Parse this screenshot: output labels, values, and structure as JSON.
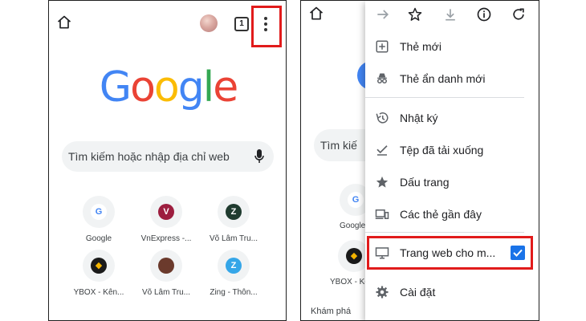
{
  "left": {
    "tab_count": "1",
    "logo_letters": [
      {
        "ch": "G",
        "color": "#4285F4"
      },
      {
        "ch": "o",
        "color": "#EA4335"
      },
      {
        "ch": "o",
        "color": "#FBBC05"
      },
      {
        "ch": "g",
        "color": "#4285F4"
      },
      {
        "ch": "l",
        "color": "#34A853"
      },
      {
        "ch": "e",
        "color": "#EA4335"
      }
    ],
    "search_placeholder": "Tìm kiếm hoặc nhập địa chỉ web",
    "tiles": [
      {
        "label": "Google",
        "letter": "G",
        "bg": "#ffffff",
        "fg": "#4285F4"
      },
      {
        "label": "VnExpress -...",
        "letter": "V",
        "bg": "#9d1e3f",
        "fg": "#ffffff"
      },
      {
        "label": "Võ Lâm Tru...",
        "letter": "Z",
        "bg": "#1f3b2f",
        "fg": "#ffffff"
      },
      {
        "label": "YBOX - Kên...",
        "letter": "◆",
        "bg": "#1a1a1a",
        "fg": "#f4b400"
      },
      {
        "label": "Võ Lâm Tru...",
        "letter": "",
        "bg": "#6b3a2c",
        "fg": "#ffffff"
      },
      {
        "label": "Zing - Thôn...",
        "letter": "Z",
        "bg": "#35a6e8",
        "fg": "#ffffff"
      }
    ]
  },
  "right": {
    "search_partial": "Tìm kiế",
    "tile_labels": [
      "Google",
      "YBOX - Kê"
    ],
    "discover_label": "Khám phá",
    "menu_items": [
      {
        "label": "Thẻ mới",
        "icon": "plus-box-icon"
      },
      {
        "label": "Thẻ ẩn danh mới",
        "icon": "incognito-icon"
      },
      {
        "label": "Nhật ký",
        "icon": "history-icon"
      },
      {
        "label": "Tệp đã tải xuống",
        "icon": "download-check-icon"
      },
      {
        "label": "Dấu trang",
        "icon": "star-filled-icon"
      },
      {
        "label": "Các thẻ gần đây",
        "icon": "devices-icon"
      },
      {
        "label": "Trang web cho m...",
        "icon": "desktop-icon"
      },
      {
        "label": "Cài đặt",
        "icon": "gear-icon"
      }
    ],
    "desktop_checked": true
  },
  "colors": {
    "highlight": "#e11b1b",
    "checkbox": "#1a73e8"
  }
}
